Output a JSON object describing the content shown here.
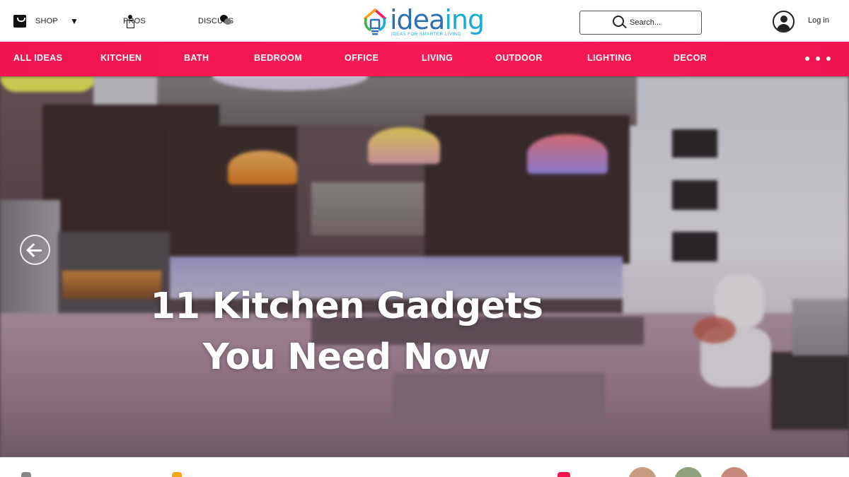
{
  "topbar": {
    "shop_label": "SHOP",
    "pros_label": "PROS",
    "discuss_label": "DISCUSS",
    "search_placeholder": "Search...",
    "login_label": "Log in"
  },
  "logo": {
    "word_part1": "idea",
    "word_part2": "ing",
    "tagline": "IDEAS FOR SMARTER LIVING"
  },
  "categories": [
    "ALL IDEAS",
    "KITCHEN",
    "BATH",
    "BEDROOM",
    "OFFICE",
    "LIVING",
    "OUTDOOR",
    "LIGHTING",
    "DECOR"
  ],
  "hero": {
    "title_line1": "11 Kitchen Gadgets",
    "title_line2": "You Need Now"
  },
  "icons": {
    "shop": "shopping-bag-icon",
    "dropdown": "caret-down-icon",
    "pros": "person-icon",
    "discuss": "chat-bubbles-icon",
    "search": "search-icon",
    "account": "user-avatar-icon",
    "more": "more-dots-icon",
    "carousel_prev": "arrow-left-icon"
  },
  "colors": {
    "brand_pink": "#f91a55",
    "logo_blue": "#2c6fb5",
    "logo_cyan": "#1ba9d6"
  }
}
